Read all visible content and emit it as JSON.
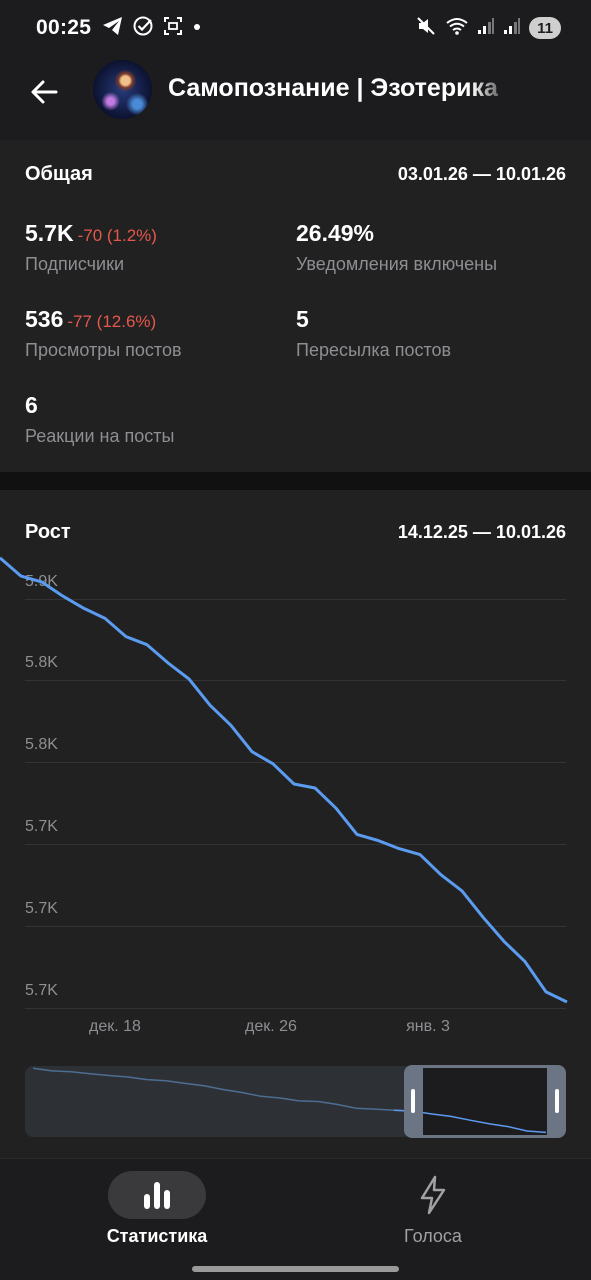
{
  "status_bar": {
    "time": "00:25",
    "battery": "11"
  },
  "header": {
    "channel_title": "Самопознание | Эзотерика"
  },
  "overview": {
    "title": "Общая",
    "date_range": "03.01.26 — 10.01.26",
    "stats": [
      {
        "value": "5.7K",
        "delta": "-70 (1.2%)",
        "label": "Подписчики"
      },
      {
        "value": "26.49%",
        "delta": "",
        "label": "Уведомления включены"
      },
      {
        "value": "536",
        "delta": "-77 (12.6%)",
        "label": "Просмотры постов"
      },
      {
        "value": "5",
        "delta": "",
        "label": "Пересылка постов"
      },
      {
        "value": "6",
        "delta": "",
        "label": "Реакции на посты"
      }
    ]
  },
  "growth": {
    "title": "Рост",
    "date_range": "14.12.25 — 10.01.26"
  },
  "chart_data": {
    "type": "line",
    "title": "Рост",
    "y_tick_labels": [
      "5.9K",
      "5.8K",
      "5.8K",
      "5.7K",
      "5.7K",
      "5.7K"
    ],
    "x_tick_labels": [
      "дек. 18",
      "дек. 26",
      "янв. 3"
    ],
    "series": [
      {
        "color": "#5b9bf0",
        "x": [
          "14.12",
          "15.12",
          "16.12",
          "17.12",
          "18.12",
          "19.12",
          "20.12",
          "21.12",
          "22.12",
          "23.12",
          "24.12",
          "25.12",
          "26.12",
          "27.12",
          "28.12",
          "29.12",
          "30.12",
          "31.12",
          "01.01",
          "02.01",
          "03.01",
          "04.01",
          "05.01",
          "06.01",
          "07.01",
          "08.01",
          "09.01",
          "10.01"
        ],
        "values": [
          5920,
          5911,
          5908,
          5901,
          5895,
          5890,
          5881,
          5877,
          5868,
          5860,
          5847,
          5837,
          5824,
          5818,
          5808,
          5806,
          5796,
          5783,
          5780,
          5776,
          5773,
          5763,
          5755,
          5742,
          5730,
          5720,
          5705,
          5700
        ]
      }
    ],
    "ylim": [
      5698,
      5914
    ],
    "grid": true,
    "navigator_range": [
      0.71,
      1.0
    ]
  },
  "bottom_nav": {
    "items": [
      {
        "label": "Статистика",
        "active": true
      },
      {
        "label": "Голоса",
        "active": false
      }
    ]
  }
}
